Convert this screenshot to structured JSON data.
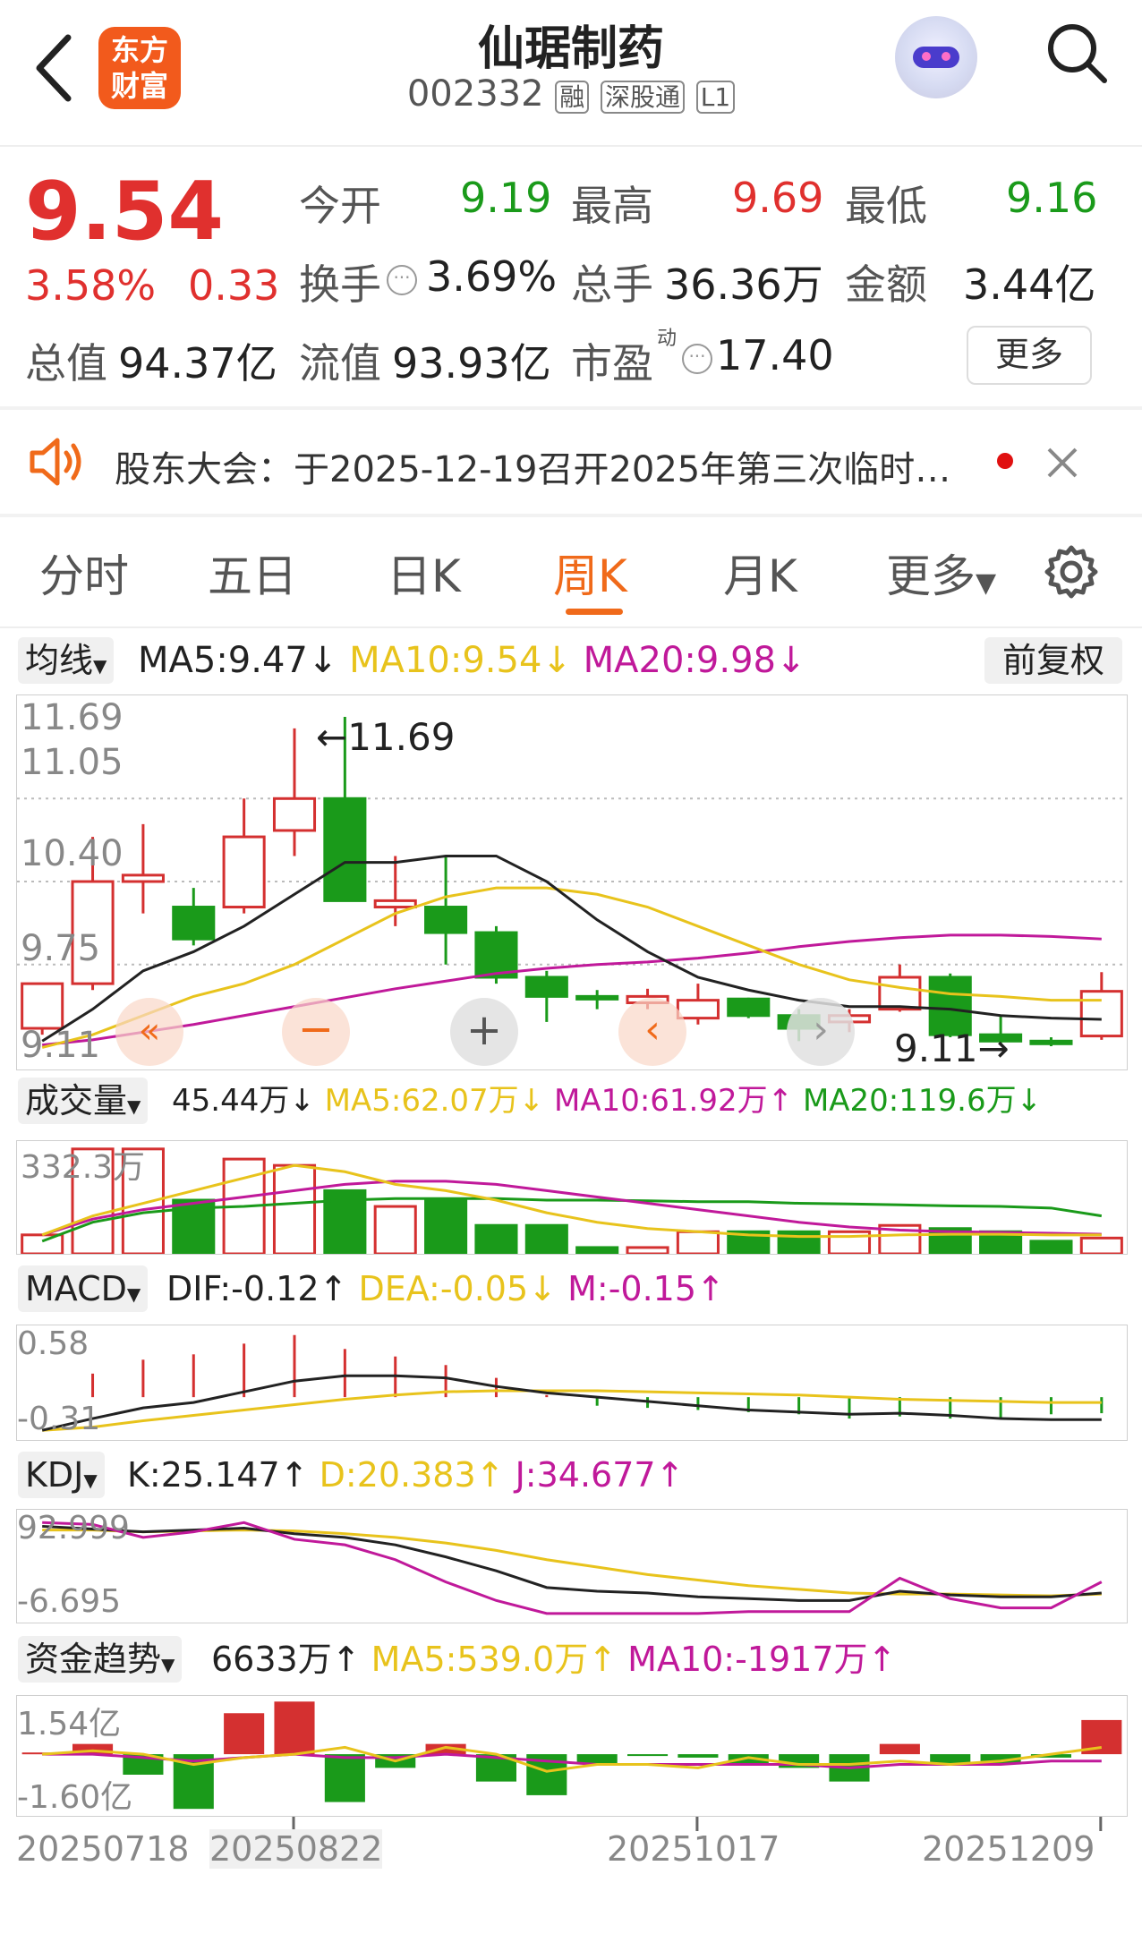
{
  "header": {
    "title": "仙琚制药",
    "code": "002332",
    "tags": [
      "融",
      "深股通",
      "L1"
    ],
    "logo_line1": "东方",
    "logo_line2": "财富"
  },
  "quote": {
    "price": "9.54",
    "pct": "3.58%",
    "chg": "0.33",
    "open_label": "今开",
    "open": "9.19",
    "high_label": "最高",
    "high": "9.69",
    "low_label": "最低",
    "low": "9.16",
    "turnover_label": "换手",
    "turnover": "3.69%",
    "volume_label": "总手",
    "volume": "36.36万",
    "amount_label": "金额",
    "amount": "3.44亿",
    "mktcap_label": "总值",
    "mktcap": "94.37亿",
    "float_label": "流值",
    "float": "93.93亿",
    "pe_label": "市盈",
    "pe_sup": "动",
    "pe": "17.40",
    "more": "更多"
  },
  "notice": {
    "text": "股东大会：于2025-12-19召开2025年第三次临时…"
  },
  "tabs": [
    "分时",
    "五日",
    "日K",
    "周K",
    "月K",
    "更多"
  ],
  "active_tab": "周K",
  "ma": {
    "selector": "均线",
    "ma5": "MA5:9.47",
    "ma10": "MA10:9.54",
    "ma20": "MA20:9.98",
    "adjust": "前复权"
  },
  "price_axis": {
    "labels": [
      "11.69",
      "11.05",
      "10.40",
      "9.75",
      "9.11"
    ],
    "max_note": "←11.69",
    "min_note": "9.11→"
  },
  "vol": {
    "selector": "成交量",
    "val": "45.44万",
    "ma5": "MA5:62.07万",
    "ma10": "MA10:61.92万",
    "ma20": "MA20:119.6万",
    "axis": "332.3万"
  },
  "macd": {
    "selector": "MACD",
    "dif": "DIF:-0.12",
    "dea": "DEA:-0.05",
    "m": "M:-0.15",
    "top": "0.58",
    "bottom": "-0.31"
  },
  "kdj": {
    "selector": "KDJ",
    "k": "K:25.147",
    "d": "D:20.383",
    "j": "J:34.677",
    "top": "92.999",
    "bottom": "-6.695"
  },
  "fund": {
    "selector": "资金趋势",
    "val": "6633万",
    "ma5": "MA5:539.0万",
    "ma10": "MA10:-1917万",
    "top": "1.54亿",
    "bottom": "-1.60亿"
  },
  "dates": [
    "20250718",
    "20250822",
    "20251017",
    "20251209"
  ],
  "colors": {
    "up": "#d43030",
    "down": "#1a9a1a",
    "ma5": "#222222",
    "ma10": "#e8c31c",
    "ma20": "#c0199a",
    "accent": "#f06a1a"
  },
  "chart_data": {
    "type": "candlestick",
    "candles": [
      {
        "o": 9.25,
        "c": 9.6,
        "h": 9.6,
        "l": 9.2
      },
      {
        "o": 9.6,
        "c": 10.4,
        "h": 10.75,
        "l": 9.55
      },
      {
        "o": 10.4,
        "c": 10.45,
        "h": 10.85,
        "l": 10.15
      },
      {
        "o": 10.2,
        "c": 9.95,
        "h": 10.35,
        "l": 9.9
      },
      {
        "o": 10.2,
        "c": 10.75,
        "h": 11.05,
        "l": 10.15
      },
      {
        "o": 10.8,
        "c": 11.05,
        "h": 11.6,
        "l": 10.6
      },
      {
        "o": 11.05,
        "c": 10.25,
        "h": 11.69,
        "l": 10.25
      },
      {
        "o": 10.2,
        "c": 10.25,
        "h": 10.6,
        "l": 10.05
      },
      {
        "o": 10.2,
        "c": 10.0,
        "h": 10.6,
        "l": 9.75
      },
      {
        "o": 10.0,
        "c": 9.65,
        "h": 10.05,
        "l": 9.6
      },
      {
        "o": 9.65,
        "c": 9.5,
        "h": 9.7,
        "l": 9.3
      },
      {
        "o": 9.5,
        "c": 9.48,
        "h": 9.55,
        "l": 9.4
      },
      {
        "o": 9.45,
        "c": 9.5,
        "h": 9.56,
        "l": 9.4
      },
      {
        "o": 9.33,
        "c": 9.47,
        "h": 9.6,
        "l": 9.28
      },
      {
        "o": 9.48,
        "c": 9.35,
        "h": 9.49,
        "l": 9.33
      },
      {
        "o": 9.35,
        "c": 9.25,
        "h": 9.4,
        "l": 9.15
      },
      {
        "o": 9.3,
        "c": 9.35,
        "h": 9.4,
        "l": 9.22
      },
      {
        "o": 9.4,
        "c": 9.65,
        "h": 9.75,
        "l": 9.38
      },
      {
        "o": 9.65,
        "c": 9.2,
        "h": 9.68,
        "l": 9.18
      },
      {
        "o": 9.2,
        "c": 9.15,
        "h": 9.35,
        "l": 9.12
      },
      {
        "o": 9.15,
        "c": 9.13,
        "h": 9.18,
        "l": 9.11
      },
      {
        "o": 9.19,
        "c": 9.54,
        "h": 9.69,
        "l": 9.16
      }
    ],
    "ma5": [
      9.15,
      9.4,
      9.7,
      9.85,
      10.05,
      10.3,
      10.55,
      10.55,
      10.6,
      10.6,
      10.4,
      10.1,
      9.85,
      9.65,
      9.55,
      9.47,
      9.42,
      9.42,
      9.4,
      9.35,
      9.33,
      9.32
    ],
    "ma10": [
      9.1,
      9.2,
      9.35,
      9.5,
      9.6,
      9.75,
      9.95,
      10.15,
      10.28,
      10.35,
      10.35,
      10.3,
      10.2,
      10.05,
      9.9,
      9.75,
      9.63,
      9.57,
      9.52,
      9.5,
      9.47,
      9.47
    ],
    "ma20": [
      9.12,
      9.16,
      9.22,
      9.28,
      9.35,
      9.42,
      9.49,
      9.56,
      9.62,
      9.68,
      9.72,
      9.75,
      9.77,
      9.8,
      9.84,
      9.89,
      9.93,
      9.96,
      9.98,
      9.98,
      9.97,
      9.95
    ],
    "volume": [
      60,
      332,
      332,
      170,
      300,
      280,
      200,
      150,
      170,
      90,
      90,
      20,
      20,
      70,
      70,
      70,
      70,
      90,
      80,
      70,
      40,
      50
    ],
    "vol_ma5": [
      60,
      120,
      160,
      200,
      240,
      280,
      260,
      220,
      200,
      170,
      130,
      100,
      80,
      70,
      60,
      55,
      55,
      60,
      62,
      62,
      60,
      60
    ],
    "vol_ma10": [
      60,
      110,
      140,
      160,
      180,
      200,
      220,
      230,
      230,
      220,
      200,
      180,
      160,
      140,
      120,
      100,
      85,
      75,
      70,
      68,
      65,
      62
    ],
    "vol_ma20": [
      40,
      100,
      130,
      145,
      150,
      160,
      170,
      175,
      175,
      175,
      170,
      170,
      168,
      165,
      165,
      160,
      158,
      155,
      152,
      150,
      145,
      120
    ],
    "macd_hist": [
      0.0,
      0.22,
      0.35,
      0.4,
      0.5,
      0.58,
      0.45,
      0.38,
      0.3,
      0.18,
      0.02,
      -0.08,
      -0.1,
      -0.12,
      -0.14,
      -0.16,
      -0.2,
      -0.18,
      -0.2,
      -0.2,
      -0.16,
      -0.15
    ],
    "dif": [
      -0.31,
      -0.2,
      -0.1,
      -0.05,
      0.05,
      0.15,
      0.2,
      0.2,
      0.18,
      0.1,
      0.04,
      0.0,
      -0.04,
      -0.08,
      -0.12,
      -0.14,
      -0.16,
      -0.15,
      -0.17,
      -0.2,
      -0.21,
      -0.21
    ],
    "dea": [
      -0.31,
      -0.28,
      -0.22,
      -0.17,
      -0.12,
      -0.07,
      -0.02,
      0.02,
      0.05,
      0.06,
      0.06,
      0.06,
      0.05,
      0.04,
      0.03,
      0.02,
      0.0,
      -0.02,
      -0.03,
      -0.04,
      -0.05,
      -0.05
    ],
    "k": [
      88,
      85,
      82,
      84,
      86,
      80,
      76,
      68,
      55,
      40,
      22,
      18,
      16,
      12,
      10,
      8,
      8,
      18,
      14,
      12,
      12,
      16
    ],
    "d": [
      84,
      84,
      82,
      83,
      84,
      83,
      80,
      76,
      70,
      62,
      52,
      44,
      36,
      30,
      24,
      20,
      16,
      15,
      15,
      14,
      13,
      15
    ],
    "j": [
      92,
      90,
      76,
      82,
      92,
      74,
      68,
      52,
      28,
      8,
      -6,
      -6,
      -6,
      -6,
      -4,
      -4,
      -4,
      32,
      10,
      0,
      0,
      28
    ],
    "fund_flow": [
      0.05,
      0.3,
      -0.6,
      -1.6,
      1.2,
      1.54,
      -1.4,
      -0.4,
      0.3,
      -0.8,
      -1.2,
      -0.3,
      -0.05,
      -0.1,
      -0.3,
      -0.4,
      -0.8,
      0.3,
      -0.3,
      -0.3,
      -0.1,
      1.0
    ],
    "fund_ma5": [
      0.0,
      0.1,
      0.0,
      -0.3,
      -0.1,
      0.0,
      0.2,
      -0.2,
      0.2,
      0.0,
      -0.5,
      -0.3,
      -0.3,
      -0.4,
      -0.1,
      -0.3,
      -0.3,
      -0.2,
      -0.3,
      -0.2,
      0.0,
      0.2
    ],
    "fund_ma10": [
      0.0,
      0.0,
      -0.1,
      -0.2,
      -0.1,
      0.0,
      -0.1,
      -0.1,
      0.0,
      -0.1,
      -0.2,
      -0.3,
      -0.3,
      -0.3,
      -0.3,
      -0.3,
      -0.4,
      -0.3,
      -0.3,
      -0.3,
      -0.2,
      -0.2
    ],
    "price_range": [
      9.11,
      11.69
    ],
    "x_tick_labels": [
      "20250718",
      "20250822",
      "20251017",
      "20251209"
    ]
  }
}
